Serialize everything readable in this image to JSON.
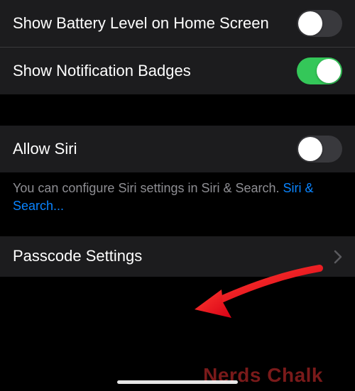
{
  "rows": {
    "battery": {
      "label": "Show Battery Level on Home Screen",
      "on": false
    },
    "badges": {
      "label": "Show Notification Badges",
      "on": true
    },
    "siri": {
      "label": "Allow Siri",
      "on": false
    },
    "passcode": {
      "label": "Passcode Settings"
    }
  },
  "footer": {
    "text_prefix": "You can configure Siri settings in Siri & Search. ",
    "link_text": "Siri & Search..."
  },
  "watermark": "Nerds Chalk"
}
